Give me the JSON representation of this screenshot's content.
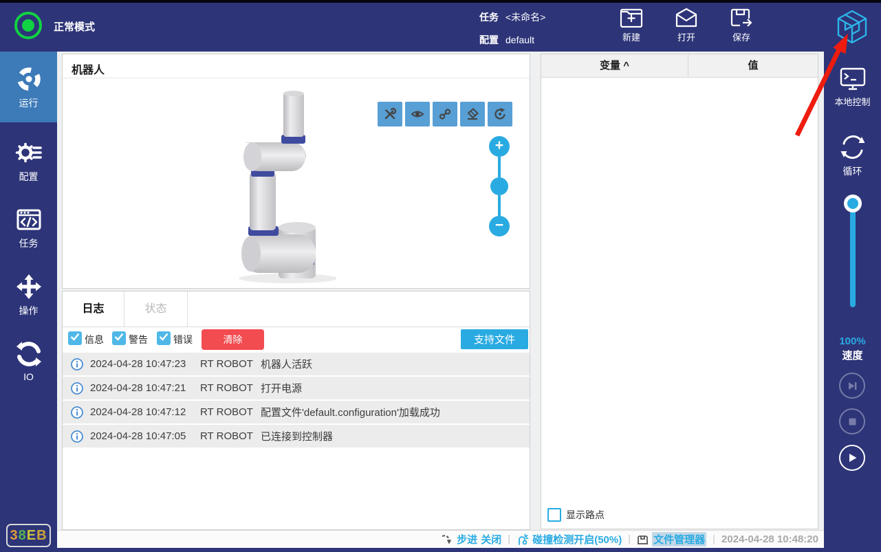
{
  "colors": {
    "navy": "#2d3478",
    "active_item_blue": "#3d7ab8",
    "accent_blue": "#29abe2",
    "toolbar_button_blue": "#579fd4",
    "clear_red": "#f24b50",
    "status_green": "#11d243",
    "arrow_red": "#ee1c0f"
  },
  "top_bar": {
    "mode_label": "正常模式",
    "task_label": "任务",
    "task_value": "<未命名>",
    "config_label": "配置",
    "config_value": "default",
    "actions": [
      {
        "label": "新建",
        "icon": "new-task-icon"
      },
      {
        "label": "打开",
        "icon": "open-icon"
      },
      {
        "label": "保存",
        "icon": "save-icon"
      }
    ],
    "logo_icon": "cube-logo-icon"
  },
  "left_sidebar": {
    "items": [
      {
        "label": "运行",
        "icon": "run-icon",
        "active": true
      },
      {
        "label": "配置",
        "icon": "config-gear-icon",
        "active": false
      },
      {
        "label": "任务",
        "icon": "task-code-icon",
        "active": false
      },
      {
        "label": "操作",
        "icon": "operate-move-icon",
        "active": false
      },
      {
        "label": "IO",
        "icon": "io-sync-icon",
        "active": false
      }
    ],
    "badge": {
      "chars": [
        {
          "ch": "3",
          "color": "#dd9a3c"
        },
        {
          "ch": "8",
          "color": "#55b254"
        },
        {
          "ch": "E",
          "color": "#c9c23a"
        },
        {
          "ch": "B",
          "color": "#cda43c"
        }
      ]
    }
  },
  "robot_panel": {
    "title": "机器人",
    "toolbar_icons": [
      "tools-icon",
      "eye-icon",
      "path-icon",
      "eraser-icon",
      "rotate-icon"
    ],
    "zoom_in_glyph": "+",
    "zoom_out_glyph": "−"
  },
  "log_panel": {
    "tabs": [
      {
        "label": "日志",
        "active": true
      },
      {
        "label": "状态",
        "active": false
      }
    ],
    "filters": [
      {
        "label": "信息",
        "checked": true
      },
      {
        "label": "警告",
        "checked": true
      },
      {
        "label": "错误",
        "checked": true
      }
    ],
    "clear_button": "清除",
    "support_button": "支持文件",
    "entries": [
      {
        "time": "2024-04-28 10:47:23",
        "source": "RT ROBOT",
        "message": "机器人活跃"
      },
      {
        "time": "2024-04-28 10:47:21",
        "source": "RT ROBOT",
        "message": "打开电源"
      },
      {
        "time": "2024-04-28 10:47:12",
        "source": "RT ROBOT",
        "message": "配置文件'default.configuration'加载成功"
      },
      {
        "time": "2024-04-28 10:47:05",
        "source": "RT ROBOT",
        "message": "已连接到控制器"
      }
    ]
  },
  "variables_panel": {
    "col_variable": "变量",
    "sort_caret": "^",
    "col_value": "值",
    "show_waypoints_label": "显示路点",
    "show_waypoints_checked": false
  },
  "right_sidebar": {
    "local_control_label": "本地控制",
    "loop_label": "循环",
    "speed_percent": "100%",
    "speed_label": "速度",
    "playback_icons": [
      "skip-next-icon",
      "stop-icon",
      "play-icon"
    ]
  },
  "status_bar": {
    "step_label": "步进",
    "step_state": "关闭",
    "collision_label": "碰撞检测开启(50%)",
    "file_manager_label": "文件管理器",
    "timestamp": "2024-04-28 10:48:20"
  }
}
